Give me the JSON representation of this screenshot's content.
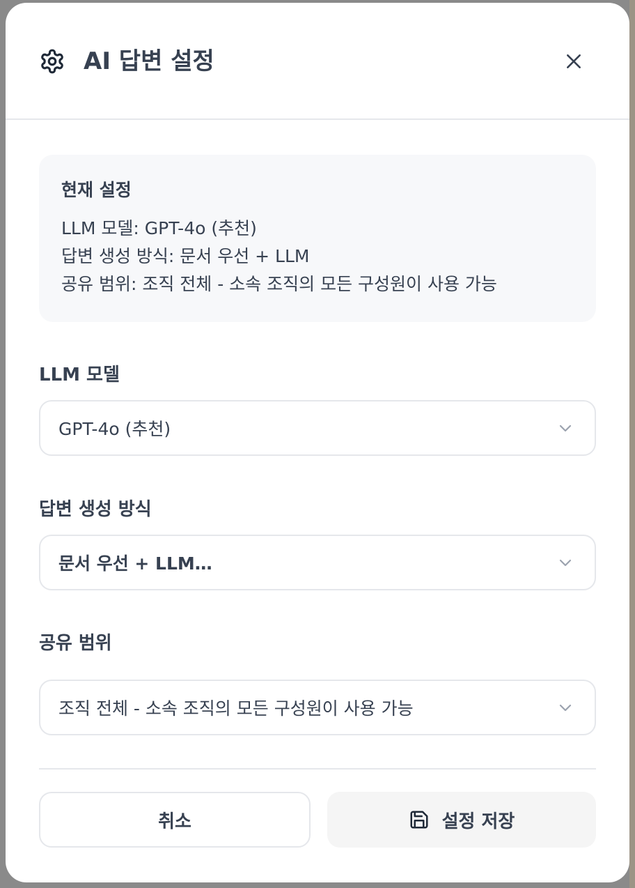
{
  "dialog": {
    "title": "AI 답변 설정",
    "icon": "gear-icon",
    "close_icon": "close-icon"
  },
  "summary": {
    "title": "현재 설정",
    "lines": [
      "LLM 모델: GPT-4o (추천)",
      "답변 생성 방식: 문서 우선 + LLM",
      "공유 범위: 조직 전체 - 소속 조직의 모든 구성원이 사용 가능"
    ]
  },
  "fields": {
    "model": {
      "label": "LLM 모델",
      "value": "GPT-4o (추천)"
    },
    "mode": {
      "label": "답변 생성 방식",
      "value": "문서 우선 + LLM…"
    },
    "scope": {
      "label": "공유 범위",
      "value": "조직 전체 - 소속 조직의 모든 구성원이 사용 가능"
    }
  },
  "actions": {
    "cancel_label": "취소",
    "save_label": "설정 저장",
    "save_icon": "floppy-disk-icon"
  },
  "colors": {
    "text": "#374151",
    "border": "#e5e7eb",
    "summary_bg": "#f7f8fa",
    "save_bg": "#f5f5f5"
  }
}
